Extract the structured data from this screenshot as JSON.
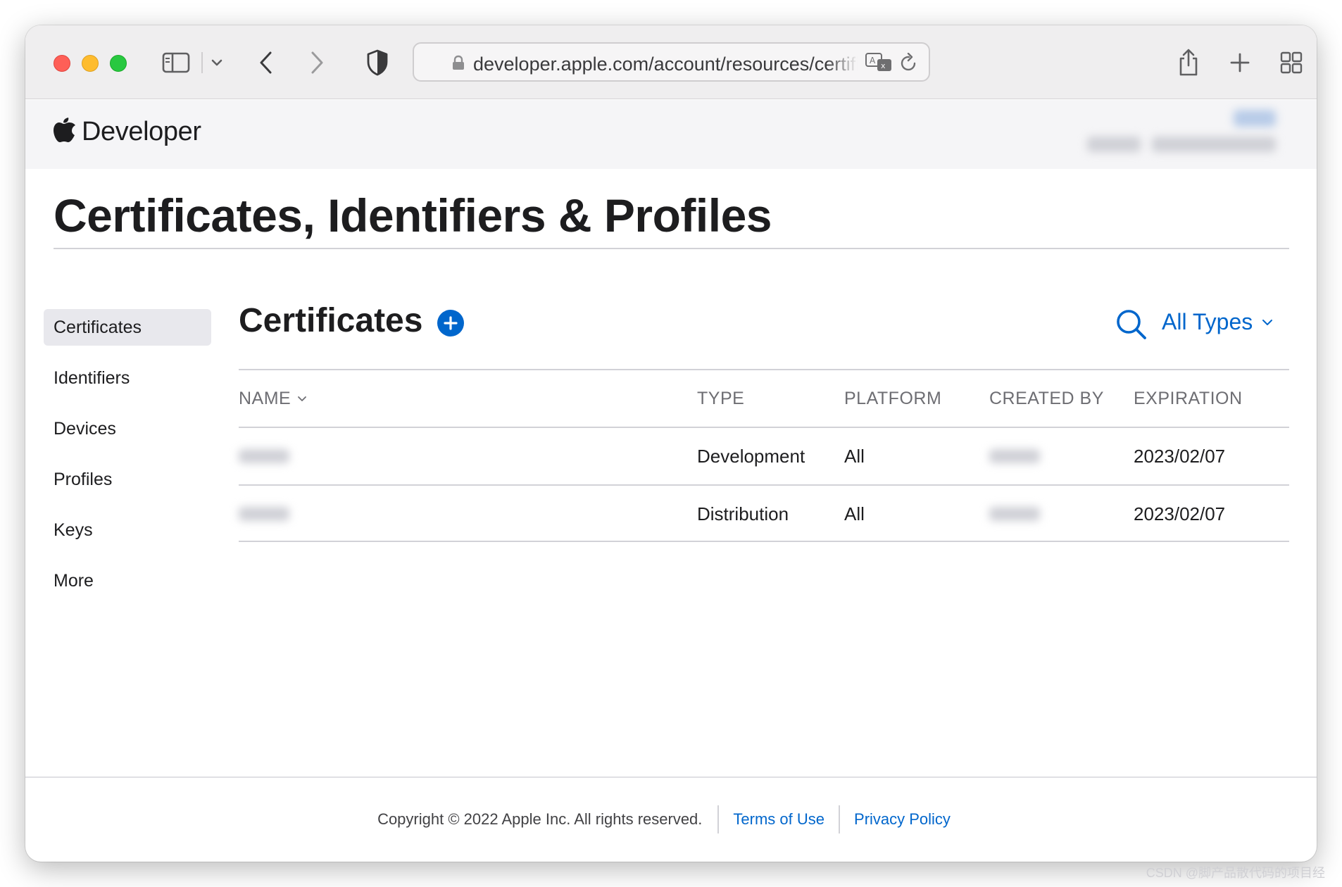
{
  "browser": {
    "url": "developer.apple.com/account/resources/certificates/list"
  },
  "header": {
    "brand": "Developer"
  },
  "page": {
    "title": "Certificates, Identifiers & Profiles"
  },
  "sidebar": {
    "items": [
      {
        "label": "Certificates",
        "active": true
      },
      {
        "label": "Identifiers"
      },
      {
        "label": "Devices"
      },
      {
        "label": "Profiles"
      },
      {
        "label": "Keys"
      },
      {
        "label": "More"
      }
    ]
  },
  "main": {
    "section_title": "Certificates",
    "filter_label": "All Types",
    "table": {
      "columns": [
        "NAME",
        "TYPE",
        "PLATFORM",
        "CREATED BY",
        "EXPIRATION"
      ],
      "rows": [
        {
          "type": "Development",
          "platform": "All",
          "expiration": "2023/02/07"
        },
        {
          "type": "Distribution",
          "platform": "All",
          "expiration": "2023/02/07"
        }
      ]
    }
  },
  "footer": {
    "copyright": "Copyright © 2022 Apple Inc. All rights reserved.",
    "terms": "Terms of Use",
    "privacy": "Privacy Policy"
  },
  "watermark": "CSDN @脚产品散代码的项目经"
}
